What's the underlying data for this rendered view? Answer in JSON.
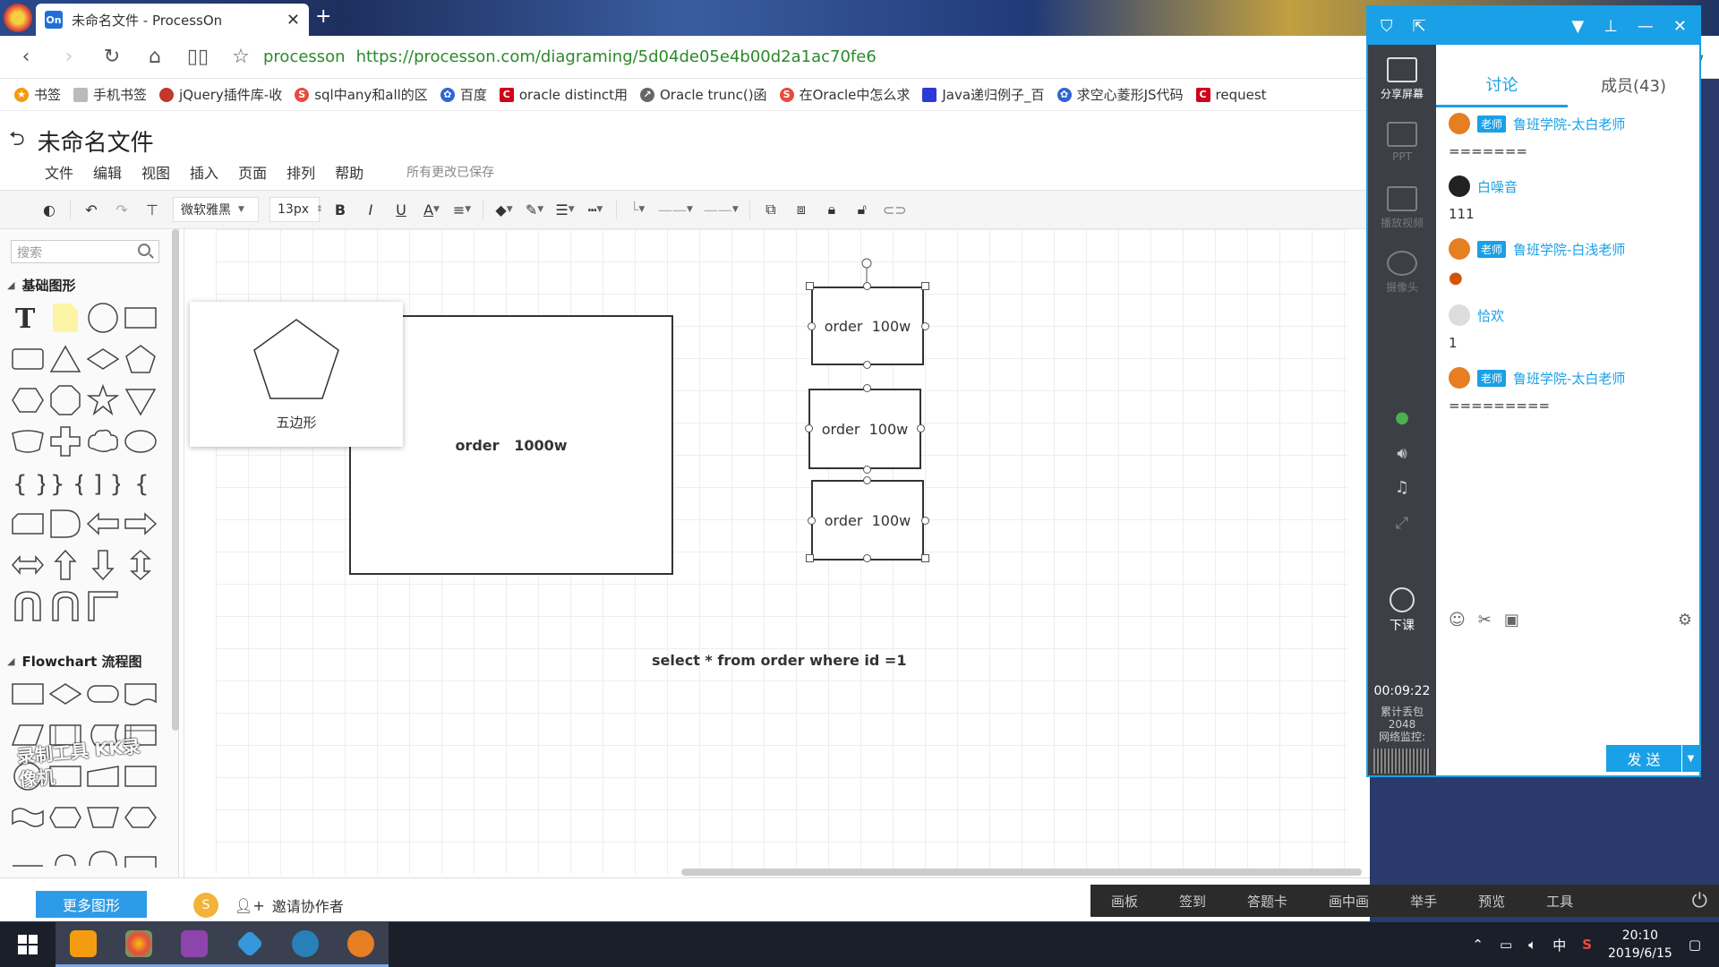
{
  "browser": {
    "tab_title": "未命名文件 - ProcessOn",
    "tab_favicon": "On",
    "site_label": "processon",
    "url": "https://processon.com/diagraming/5d04de05e4b00d2a1ac70fe6",
    "bookmarks": [
      "书签",
      "手机书签",
      "jQuery插件库-收",
      "sql中any和all的区",
      "百度",
      "oracle distinct用",
      "Oracle trunc()函",
      "在Oracle中怎么求",
      "Java递归例子_百",
      "求空心菱形JS代码",
      "request"
    ]
  },
  "app": {
    "doc_title": "未命名文件",
    "menus": [
      "文件",
      "编辑",
      "视图",
      "插入",
      "页面",
      "排列",
      "帮助"
    ],
    "save_status": "所有更改已保存",
    "toolbar": {
      "font": "微软雅黑",
      "size": "13px"
    }
  },
  "sidebar": {
    "search_placeholder": "搜索",
    "cat_basic": "基础图形",
    "cat_flow": "Flowchart 流程图",
    "watermark": "录制工具 KK录像机",
    "more_button": "更多图形"
  },
  "canvas": {
    "tooltip_label": "五边形",
    "big_box": "order   1000w",
    "small_boxes": [
      "order  100w",
      "order  100w",
      "order  100w"
    ],
    "sql": "select * from order where id =1"
  },
  "footer": {
    "avatar": "S",
    "invite": "邀请协作者",
    "controls": [
      "画板",
      "签到",
      "答题卡",
      "画中画",
      "举手",
      "预览",
      "工具"
    ]
  },
  "chat": {
    "tab_discuss": "讨论",
    "tab_members": "成员(43)",
    "left_items": [
      "分享屏幕",
      "PPT",
      "播放视频",
      "摄像头",
      "下课"
    ],
    "timer": "00:09:22",
    "stats": [
      "累计丢包",
      "2048",
      "网络监控:"
    ],
    "badge": "老师",
    "messages": [
      {
        "name": "鲁班学院-太白老师",
        "teacher": true,
        "text": "======="
      },
      {
        "name": "白噪音",
        "teacher": false,
        "text": "111"
      },
      {
        "name": "鲁班学院-白浅老师",
        "teacher": true,
        "text": ""
      },
      {
        "name": "恰欢",
        "teacher": false,
        "text": "1"
      },
      {
        "name": "鲁班学院-太白老师",
        "teacher": true,
        "text": "========="
      }
    ],
    "send": "发 送"
  },
  "taskbar": {
    "ime": "中",
    "time": "20:10",
    "date": "2019/6/15"
  },
  "colors": {
    "accent": "#1aa0e6",
    "more_btn": "#2d9be8"
  }
}
